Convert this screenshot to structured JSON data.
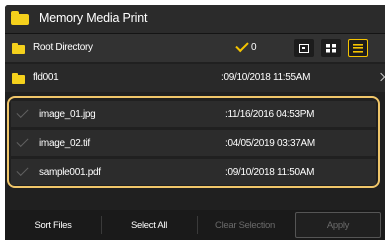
{
  "app": {
    "title": "Memory Media Print"
  },
  "path_bar": {
    "directory_label": "Root Directory",
    "selected_count": "0",
    "view_modes": [
      "thumbnail",
      "grid",
      "list"
    ],
    "active_view": "list"
  },
  "folders": [
    {
      "name": "fld001",
      "date": ":09/10/2018 11:55AM"
    }
  ],
  "files": [
    {
      "name": "image_01.jpg",
      "date": ":11/16/2016 04:53PM"
    },
    {
      "name": "image_02.tif",
      "date": ":04/05/2019 03:37AM"
    },
    {
      "name": "sample001.pdf",
      "date": ":09/10/2018 11:50AM"
    }
  ],
  "toolbar": {
    "sort_label": "Sort Files",
    "select_all_label": "Select All",
    "clear_selection_label": "Clear Selection",
    "apply_label": "Apply"
  },
  "colors": {
    "background": "#202020",
    "accent": "#f5c400",
    "folder": "#f5d11c",
    "selection_border": "#f0c66a"
  },
  "icons": {
    "title": "folder-icon",
    "path_bar": "folder-icon",
    "selected_count": "checkmark-icon",
    "folder_row": "folder-icon",
    "folder_row_more": "chevron-right-icon",
    "file_row": "checkmark-icon"
  }
}
